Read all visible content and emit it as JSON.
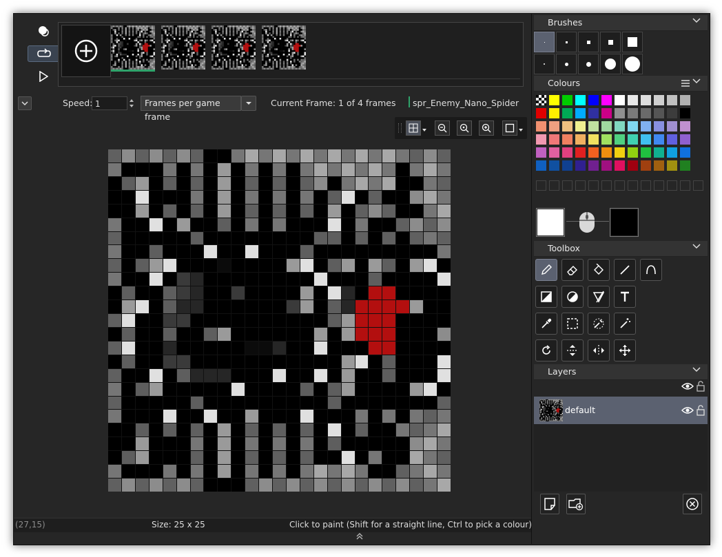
{
  "frames": {
    "add_label": "Add frame",
    "count": 4
  },
  "speed_row": {
    "speed_label": "Speed:",
    "speed_value": "1",
    "mode_value": "Frames per game frame",
    "current_frame": "Current Frame: 1 of 4 frames",
    "sprite_name": "spr_Enemy_Nano_Spider"
  },
  "status": {
    "coords": "(27,15)",
    "size": "Size: 25 x 25",
    "hint": "Click to paint (Shift for a straight line, Ctrl to pick a colour)"
  },
  "panels": {
    "brushes_title": "Brushes",
    "colours_title": "Colours",
    "toolbox_title": "Toolbox",
    "layers_title": "Layers"
  },
  "layers": [
    {
      "name": "default"
    }
  ],
  "colours": {
    "primary": "#ffffff",
    "secondary": "#000000",
    "palette_rows": [
      [
        "#000000",
        "#ffff00",
        "#00cc00",
        "#00ffff",
        "#0000ff",
        "#ff00ff",
        "#ffffff",
        "#e8e8e8",
        "#dddddd",
        "#cfcfcf",
        "#c0c0c0",
        "#b0b0b0"
      ],
      [
        "#e00000",
        "#ffee00",
        "#00aa55",
        "#00aaff",
        "#3030a0",
        "#cc0088",
        "#909090",
        "#7a7a7a",
        "#6a6a6a",
        "#555555",
        "#3c3c3c",
        "#000000"
      ],
      [
        "#f09070",
        "#f0a080",
        "#f0c080",
        "#f0f090",
        "#c0e0a0",
        "#a0d8a0",
        "#80d8c0",
        "#80d8f0",
        "#80b0f0",
        "#8890e0",
        "#a090d0",
        "#c090d0"
      ],
      [
        "#f098b0",
        "#f07878",
        "#f08060",
        "#f0b060",
        "#f0e060",
        "#a0e060",
        "#50d080",
        "#40d0b0",
        "#40c0f0",
        "#4088f0",
        "#6060e0",
        "#9060d0"
      ],
      [
        "#c060c0",
        "#e060a0",
        "#e04080",
        "#e02020",
        "#f06020",
        "#f09010",
        "#f0d010",
        "#90d010",
        "#20c040",
        "#10b090",
        "#10a0e0",
        "#1070e0"
      ],
      [
        "#1060c0",
        "#1050a0",
        "#104090",
        "#302090",
        "#702090",
        "#a01080",
        "#e01060",
        "#a00010",
        "#a04010",
        "#a06010",
        "#a09010",
        "#208020"
      ]
    ],
    "toolbar_icons": [
      "menu-icon",
      "chevron-down-icon"
    ]
  },
  "pixel_art": {
    "palette": {
      "a": "#606060",
      "b": "#8c8c8c",
      "B": "#000000",
      "K": "#0b0b0b",
      "k": "#262626",
      "d": "#3a3a3a",
      "m": "#5e5e5e",
      "g": "#9a9a9a",
      "l": "#bdbdbd",
      "W": "#e0e0e0",
      "R": "#b30f0f",
      "x": "#767676",
      "y": "#a8a8a8"
    },
    "rows": [
      "abababaBBababababababaaba",
      "aBBBaBaBgBaBaBabababaBaba",
      "BmgBmBaBgBaBaBabBababBBaa",
      "BBWBBBaBgBaBaBaBmWBaBBbba",
      "BBgBmBaBgBaBaBaBgBabaBBab",
      "aBBWBgBBmBaBaBBBWBaBBabab",
      "aBBBBBmBBBBBBBBmmBaBaBaaa",
      "aBBmBBBWBBWBBBmBBBBBBBBBa",
      "aBmgWBBBKBBBBgWBmgBgmBgWB",
      "aBBWBdkBBBBBBBBWBBBmBBBBW",
      "BmBBmdkBBdBBBBgBWkBRRBBBB",
      "BgWBmkkBBBBBBdgBmkRRRRgBB",
      "aWBBddBBBBBBBBBBmgRRRBBBB",
      "BmBBmBBmgBBBBBBgBgRRRBBBb",
      "aWBBkBBBBBKKkBBWBBBRRBBBB",
      "BmBBddBBBBBBBBBBBgWBmBBBW",
      "aBBWBmkkkBBBWBBWBgBBmBBBW",
      "aBmgBBBBBWBBBBmBmgBBBBgWB",
      "aBBBBBmBBBBBBBBBmBBBBBBBa",
      "aBBBWBBWBBgBBBWBBBaBaBaaa",
      "BBmBmBaBgBaBaBaBWBaBBaaab",
      "BBgBBBaBgBaBaBaBmBBBBBbba",
      "BmgBBBaBgBaBaBaBBWBaBBbaa",
      "aBBBaBaBgBaBaBababaBBaaba",
      "abababaBBBababababababaab"
    ]
  },
  "icons": {
    "onion": "onion-skin-icon",
    "loop": "loop-icon",
    "play": "play-icon",
    "add": "add-frame-icon"
  }
}
